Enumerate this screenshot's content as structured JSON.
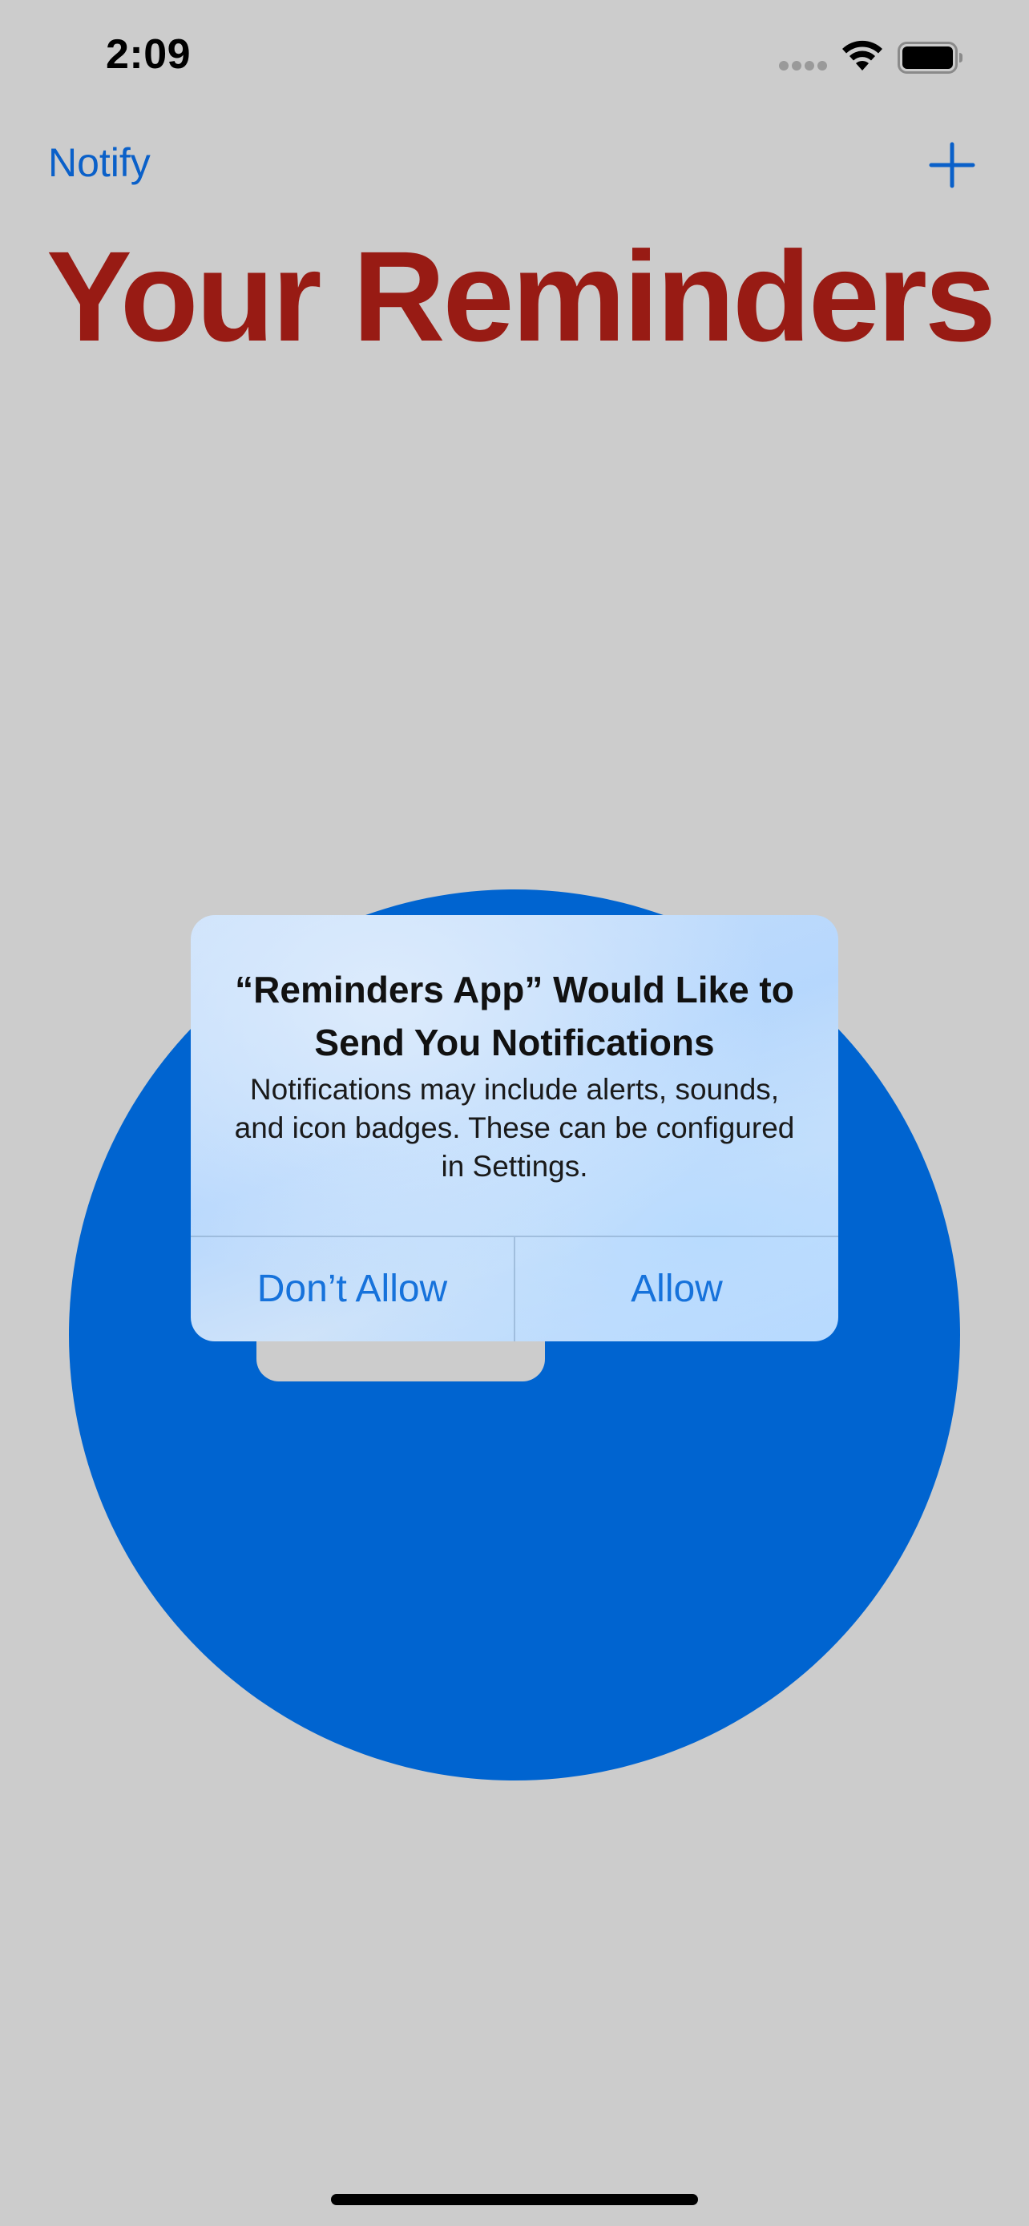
{
  "status_bar": {
    "time": "2:09",
    "icons": [
      "cellular-signal-icon",
      "wifi-icon",
      "battery-icon"
    ]
  },
  "nav": {
    "left_button_label": "Notify",
    "right_button_icon": "plus-icon",
    "large_title": "Your Reminders"
  },
  "alert": {
    "title": "“Reminders App” Would Like to Send You Notifications",
    "message": "Notifications may include alerts, sounds, and icon badges. These can be configured in Settings.",
    "buttons": [
      {
        "label": "Don’t Allow"
      },
      {
        "label": "Allow"
      }
    ]
  },
  "colors": {
    "background": "#cccccc",
    "accent_blue": "#0a60c9",
    "title_red": "#981b14",
    "circle_blue": "#0064d0",
    "alert_button_blue": "#1672db"
  }
}
